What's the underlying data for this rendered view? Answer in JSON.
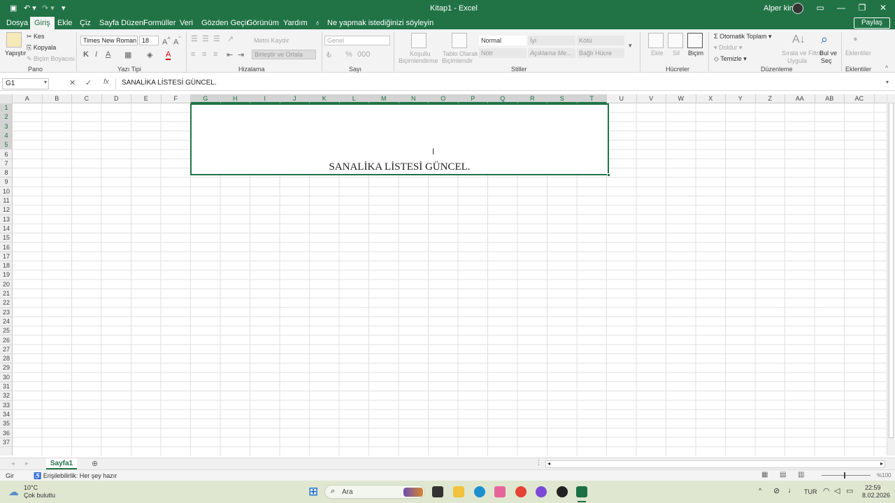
{
  "titlebar": {
    "title": "Kitap1 - Excel",
    "user": "Alper king"
  },
  "tabs": [
    "Dosya",
    "Giriş",
    "Ekle",
    "Çiz",
    "Sayfa Düzeni",
    "Formüller",
    "Veri",
    "Gözden Geçir",
    "Görünüm",
    "Yardım"
  ],
  "tell_me": "Ne yapmak istediğinizi söyleyin",
  "share": "Paylaş",
  "ribbon": {
    "paste": "Yapıştır",
    "cut": "Kes",
    "copy": "Kopyala",
    "format_painter": "Biçim Boyacısı",
    "font_name": "Times New Roman",
    "font_size": "18",
    "wrap_text": "Metni Kaydır",
    "merge": "Birleştir ve Ortala",
    "number_format": "Genel",
    "cond_format": [
      "Koşullu",
      "Biçimlendirme"
    ],
    "format_table": [
      "Tablo Olarak",
      "Biçimlendir"
    ],
    "styles": {
      "normal": "Normal",
      "good": "İyi",
      "bad": "Kötü",
      "neutral": "Nötr",
      "explanatory": "Açıklama Me...",
      "linked": "Bağlı Hücre"
    },
    "insert": "Ekle",
    "delete": "Sil",
    "format": "Biçim",
    "autosum": "Otomatik Toplam",
    "fill": "Doldur",
    "clear": "Temizle",
    "sort": [
      "Sırala ve Filtre",
      "Uygula"
    ],
    "find": [
      "Bul ve",
      "Seç"
    ],
    "addins": "Eklentiler",
    "groups": {
      "clipboard": "Pano",
      "font": "Yazı Tipi",
      "alignment": "Hizalama",
      "number": "Sayı",
      "styles": "Stiller",
      "cells": "Hücreler",
      "editing": "Düzenleme",
      "addins": "Eklentiler"
    }
  },
  "formula": {
    "namebox": "G1",
    "fx": "fx",
    "value": "SANALİKA LİSTESİ GÜNCEL."
  },
  "columns": [
    "A",
    "B",
    "C",
    "D",
    "E",
    "F",
    "G",
    "H",
    "I",
    "J",
    "K",
    "L",
    "M",
    "N",
    "O",
    "P",
    "Q",
    "R",
    "S",
    "T",
    "U",
    "V",
    "W",
    "X",
    "Y",
    "Z",
    "AA",
    "AB",
    "AC"
  ],
  "merged_cell_text": "SANALİKA LİSTESİ GÜNCEL.",
  "sheet": {
    "name": "Sayfa1"
  },
  "status": {
    "mode": "Gir",
    "accessibility": "Erişilebilirlik: Her şey hazır",
    "zoom": "%100"
  },
  "taskbar": {
    "weather_temp": "10°C",
    "weather_desc": "Çok bulutlu",
    "search": "Ara",
    "lang": "TUR",
    "time": "22:59",
    "date": "8.02.2026"
  }
}
